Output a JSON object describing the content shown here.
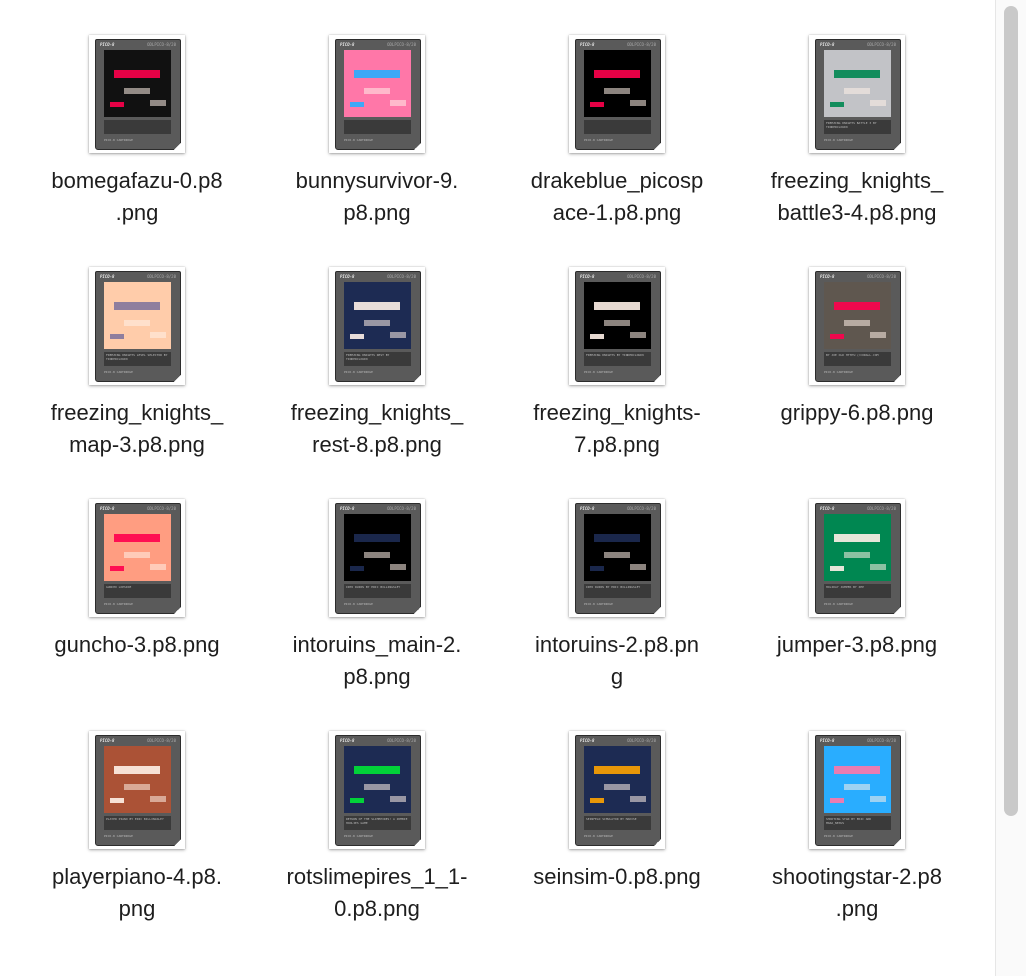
{
  "files": [
    {
      "name": "bomegafazu-0.p8\n.png",
      "screen_bg": "#111111",
      "screen_accent": "#ff004d",
      "label": "",
      "foot": "PICO-8 CARTRIDGE"
    },
    {
      "name": "bunnysurvivor-9.\np8.png",
      "screen_bg": "#ff77a8",
      "screen_accent": "#29adff",
      "label": "",
      "foot": "PICO-8 CARTRIDGE"
    },
    {
      "name": "drakeblue_picosp\nace-1.p8.png",
      "screen_bg": "#000000",
      "screen_accent": "#ff004d",
      "label": "",
      "foot": "PICO-8 CARTRIDGE"
    },
    {
      "name": "freezing_knights_\nbattle3-4.p8.png",
      "screen_bg": "#c2c3c7",
      "screen_accent": "#008751",
      "label": "FREEZING KNIGHTS BATTLE 3\nBY TINDERCLOUD9",
      "foot": "PICO-8 CARTRIDGE"
    },
    {
      "name": "freezing_knights_\nmap-3.p8.png",
      "screen_bg": "#ffccaa",
      "screen_accent": "#83769c",
      "label": "FREEZING KNIGHTS LEVEL SELECTOR\nBY TINDERCLOUD9",
      "foot": "PICO-8 CARTRIDGE"
    },
    {
      "name": "freezing_knights_\nrest-8.p8.png",
      "screen_bg": "#1d2b53",
      "screen_accent": "#fff1e8",
      "label": "FREEZING KNIGHTS REST\nBY TINDERCLOUD9",
      "foot": "PICO-8 CARTRIDGE"
    },
    {
      "name": "freezing_knights-\n7.p8.png",
      "screen_bg": "#000000",
      "screen_accent": "#fff1e8",
      "label": "FREEZING KNIGHTS\nBY TINDERCLOUD9",
      "foot": "PICO-8 CARTRIDGE"
    },
    {
      "name": "grippy-6.p8.png",
      "screen_bg": "#5f574f",
      "screen_accent": "#ff004d",
      "label": "BY JOE OLD\nHTTPS://CORALL.COM",
      "foot": "PICO-8 CARTRIDGE"
    },
    {
      "name": "guncho-3.p8.png",
      "screen_bg": "#ff9d81",
      "screen_accent": "#ff004d",
      "label": "GUNCHO\nLOPSIDE",
      "foot": "PICO-8 CARTRIDGE"
    },
    {
      "name": "intoruins_main-2.\np8.png",
      "screen_bg": "#000000",
      "screen_accent": "#1d2b53",
      "label": "INTO RUINS\nBY ERIC BILLINGSLEY",
      "foot": "PICO-8 CARTRIDGE"
    },
    {
      "name": "intoruins-2.p8.pn\ng",
      "screen_bg": "#000000",
      "screen_accent": "#1d2b53",
      "label": "INTO RUINS\nBY ERIC BILLINGSLEY",
      "foot": "PICO-8 CARTRIDGE"
    },
    {
      "name": "jumper-3.p8.png",
      "screen_bg": "#008751",
      "screen_accent": "#fff1e8",
      "label": "HOLIDAY JUMPER\nBY ZEP",
      "foot": "PICO-8 CARTRIDGE"
    },
    {
      "name": "playerpiano-4.p8.\npng",
      "screen_bg": "#ab5236",
      "screen_accent": "#fff1e8",
      "label": "PLAYER PIANO\nBY ERIC BILLINGSLEY",
      "foot": "PICO-8 CARTRIDGE"
    },
    {
      "name": "rotslimepires_1_1-\n0.p8.png",
      "screen_bg": "#1d2b53",
      "screen_accent": "#00e436",
      "label": "RETURN OF THE SLIMEPIRES!\nA ZOMBIE HOOLIES GAME",
      "foot": "PICO-8 CARTRIDGE"
    },
    {
      "name": "seinsim-0.p8.png",
      "screen_bg": "#1d2b53",
      "screen_accent": "#ffa300",
      "label": "SEINFELD SIMULATOR\nBY MAKISE",
      "foot": "PICO-8 CARTRIDGE"
    },
    {
      "name": "shootingstar-2.p8\n.png",
      "screen_bg": "#29adff",
      "screen_accent": "#ff77a8",
      "label": "SHOOTING STAR\nBY ERIC AND MARA_NEXUS",
      "foot": "PICO-8 CARTRIDGE"
    }
  ],
  "cart_brand": "PICO-8",
  "cart_model": "ODLPICO-8/20",
  "scrollbar": {
    "position_fraction": 0.0,
    "visible_fraction": 0.84
  }
}
